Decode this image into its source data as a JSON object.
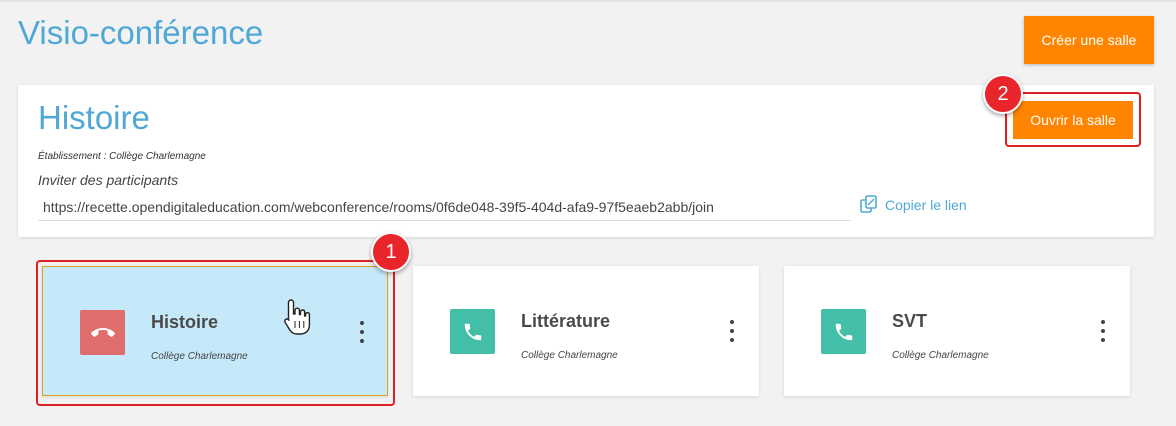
{
  "header": {
    "title": "Visio-conférence",
    "create_button": "Créer une salle"
  },
  "current_room": {
    "title": "Histoire",
    "school_line": "Établissement : Collège Charlemagne",
    "invite_label": "Inviter des participants",
    "link": "https://recette.opendigitaleducation.com/webconference/rooms/0f6de048-39f5-404d-afa9-97f5eaeb2abb/join",
    "copy_label": "Copier le lien",
    "open_button": "Ouvrir la salle"
  },
  "rooms": [
    {
      "name": "Histoire",
      "school": "Collège Charlemagne",
      "status": "active",
      "icon": "hang-up-phone-icon",
      "icon_color": "#e06c6c"
    },
    {
      "name": "Littérature",
      "school": "Collège Charlemagne",
      "status": "idle",
      "icon": "phone-icon",
      "icon_color": "#43bfa8"
    },
    {
      "name": "SVT",
      "school": "Collège Charlemagne",
      "status": "idle",
      "icon": "phone-icon",
      "icon_color": "#43bfa8"
    }
  ],
  "callouts": [
    "1",
    "2"
  ],
  "colors": {
    "accent": "#ff8500",
    "title_blue": "#4fa8d6",
    "active_card": "#c6e9f9",
    "callout_red": "#e8252b"
  }
}
